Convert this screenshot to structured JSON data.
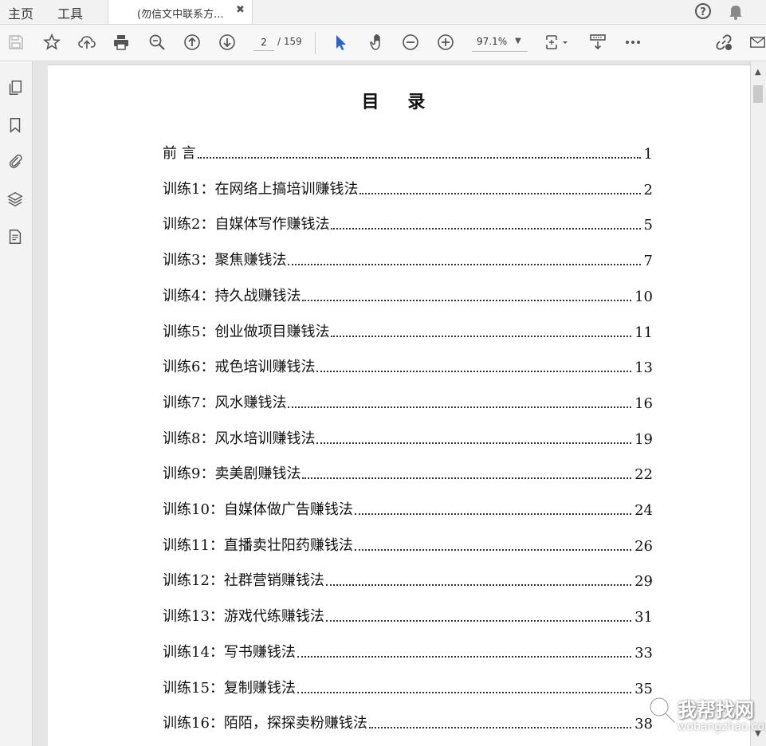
{
  "tabs": {
    "home": "主页",
    "tools": "工具",
    "document": "(勿信文中联系方..."
  },
  "toolbar": {
    "page_current": "2",
    "page_total": "/ 159",
    "zoom": "97.1%"
  },
  "document": {
    "title": "目 录",
    "toc": [
      {
        "title": "前 言",
        "page": "1"
      },
      {
        "title": "训练1：在网络上搞培训赚钱法",
        "page": "2"
      },
      {
        "title": "训练2：自媒体写作赚钱法",
        "page": "5"
      },
      {
        "title": "训练3：聚焦赚钱法",
        "page": "7"
      },
      {
        "title": "训练4：持久战赚钱法",
        "page": "10"
      },
      {
        "title": "训练5：创业做项目赚钱法",
        "page": "11"
      },
      {
        "title": "训练6：戒色培训赚钱法",
        "page": "13"
      },
      {
        "title": "训练7：风水赚钱法",
        "page": "16"
      },
      {
        "title": "训练8：风水培训赚钱法",
        "page": "19"
      },
      {
        "title": "训练9：卖美剧赚钱法",
        "page": "22"
      },
      {
        "title": "训练10：自媒体做广告赚钱法",
        "page": "24"
      },
      {
        "title": "训练11：直播卖壮阳药赚钱法",
        "page": "26"
      },
      {
        "title": "训练12：社群营销赚钱法",
        "page": "29"
      },
      {
        "title": "训练13：游戏代练赚钱法",
        "page": "31"
      },
      {
        "title": "训练14：写书赚钱法",
        "page": "33"
      },
      {
        "title": "训练15：复制赚钱法",
        "page": "35"
      },
      {
        "title": "训练16：陌陌，探探卖粉赚钱法",
        "page": "38"
      }
    ]
  },
  "watermark": {
    "name": "我帮找网",
    "url": "wobangzhao.com"
  },
  "colors": {
    "accent_blue": "#2a63c9",
    "toolbar_bg": "#f7f7f7",
    "page_bg": "#ffffff"
  }
}
